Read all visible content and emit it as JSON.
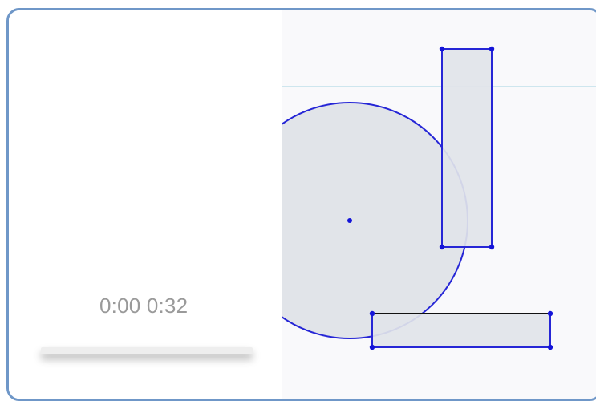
{
  "player": {
    "current_time": "0:00",
    "duration": "0:32",
    "progress_fraction": 0
  },
  "canvas": {
    "shapes": [
      {
        "kind": "circle",
        "name": "circle-shape",
        "fill": "#e1e4e9",
        "stroke": "#2626d6"
      },
      {
        "kind": "rect",
        "name": "vertical-rectangle-shape",
        "fill": "#e1e4e9",
        "stroke": "#2626d6"
      },
      {
        "kind": "rect",
        "name": "horizontal-rectangle-shape",
        "fill": "#e1e4e9",
        "stroke": "#2626d6"
      }
    ],
    "guide_line_color": "#bfe0ea",
    "point_color": "#1414d8"
  }
}
